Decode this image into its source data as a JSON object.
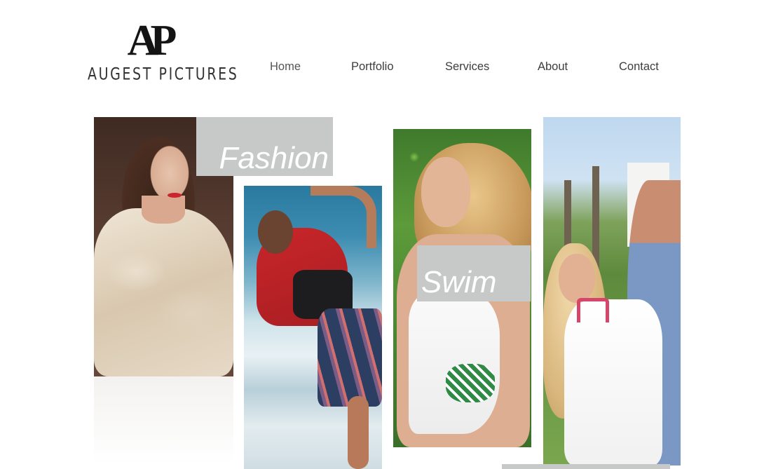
{
  "logo": {
    "mark": "AP",
    "name": "AUGEST PICTURES"
  },
  "nav": {
    "items": [
      {
        "label": "Home"
      },
      {
        "label": "Portfolio"
      },
      {
        "label": "Services"
      },
      {
        "label": "About"
      },
      {
        "label": "Contact"
      }
    ]
  },
  "gallery": {
    "categories": [
      {
        "label": "Fashion"
      },
      {
        "label": "Swim"
      }
    ]
  },
  "colors": {
    "label_background": "#c7c9c9",
    "label_text": "#ffffff",
    "nav_text": "#3d3d3d"
  }
}
